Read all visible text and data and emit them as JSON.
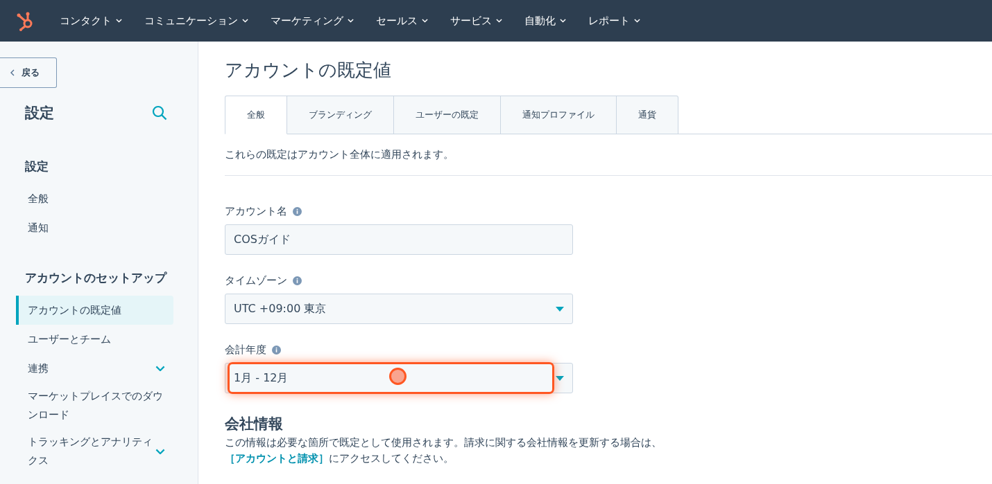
{
  "top_nav": {
    "items": [
      {
        "label": "コンタクト"
      },
      {
        "label": "コミュニケーション"
      },
      {
        "label": "マーケティング"
      },
      {
        "label": "セールス"
      },
      {
        "label": "サービス"
      },
      {
        "label": "自動化"
      },
      {
        "label": "レポート"
      }
    ]
  },
  "sidebar": {
    "back_label": "戻る",
    "title": "設定",
    "sections": [
      {
        "heading": "設定",
        "items": [
          {
            "label": "全般",
            "selected": false,
            "expandable": false
          },
          {
            "label": "通知",
            "selected": false,
            "expandable": false
          }
        ]
      },
      {
        "heading": "アカウントのセットアップ",
        "items": [
          {
            "label": "アカウントの既定値",
            "selected": true,
            "expandable": false
          },
          {
            "label": "ユーザーとチーム",
            "selected": false,
            "expandable": false
          },
          {
            "label": "連携",
            "selected": false,
            "expandable": true
          },
          {
            "label": "マーケットプレイスでのダウンロード",
            "selected": false,
            "expandable": false
          },
          {
            "label": "トラッキングとアナリティクス",
            "selected": false,
            "expandable": true
          }
        ]
      }
    ]
  },
  "page": {
    "title": "アカウントの既定値",
    "tabs": [
      {
        "label": "全般",
        "selected": true
      },
      {
        "label": "ブランディング",
        "selected": false
      },
      {
        "label": "ユーザーの既定",
        "selected": false
      },
      {
        "label": "通知プロファイル",
        "selected": false
      },
      {
        "label": "通貨",
        "selected": false
      }
    ],
    "description": "これらの既定はアカウント全体に適用されます。",
    "fields": [
      {
        "kind": "text",
        "label": "アカウント名",
        "value": "COSガイド",
        "highlighted": false
      },
      {
        "kind": "select",
        "label": "タイムゾーン",
        "value": "UTC +09:00 東京",
        "highlighted": false
      },
      {
        "kind": "select",
        "label": "会計年度",
        "value": "1月 - 12月",
        "highlighted": true
      }
    ],
    "company_info": {
      "heading": "会社情報",
      "text_before": "この情報は必要な箇所で既定として使用されます。請求に関する会社情報を更新する場合は、",
      "link": "［アカウントと請求］",
      "text_after": "にアクセスしてください。"
    }
  }
}
